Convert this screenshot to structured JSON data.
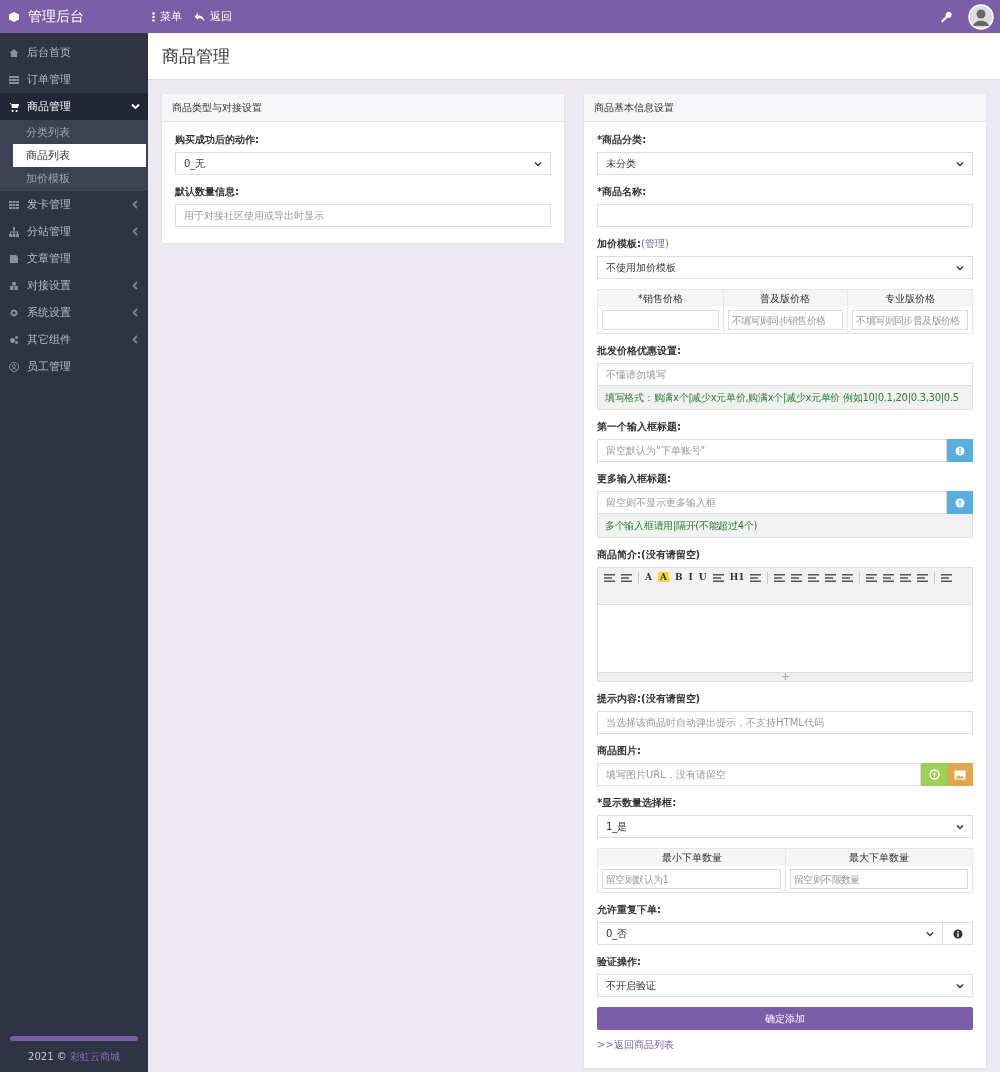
{
  "topbar": {
    "brand": "管理后台",
    "menu_button": "菜单",
    "back_button": "返回"
  },
  "sidebar": {
    "items": [
      {
        "kind": "link",
        "label": "后台首页",
        "selected": false
      },
      {
        "kind": "link",
        "label": "订单管理",
        "selected": false
      },
      {
        "kind": "group",
        "label": "商品管理",
        "expanded": true,
        "selected": true,
        "children": [
          {
            "label": "分类列表",
            "selected": false
          },
          {
            "label": "商品列表",
            "selected": true
          },
          {
            "label": "加价模板",
            "selected": false
          }
        ]
      },
      {
        "kind": "group",
        "label": "发卡管理",
        "expanded": false,
        "selected": false
      },
      {
        "kind": "group",
        "label": "分站管理",
        "expanded": false,
        "selected": false
      },
      {
        "kind": "link",
        "label": "文章管理",
        "selected": false
      },
      {
        "kind": "group",
        "label": "对接设置",
        "expanded": false,
        "selected": false
      },
      {
        "kind": "group",
        "label": "系统设置",
        "expanded": false,
        "selected": false
      },
      {
        "kind": "group",
        "label": "其它组件",
        "expanded": false,
        "selected": false
      },
      {
        "kind": "link",
        "label": "员工管理",
        "selected": false
      }
    ],
    "footer": {
      "year": "2021 ©",
      "link": "彩虹云商城"
    }
  },
  "page_title": "商品管理",
  "left_panel": {
    "title": "商品类型与对接设置",
    "fields": [
      {
        "kind": "select",
        "label": "购买成功后的动作:",
        "value": "0_无"
      },
      {
        "kind": "input",
        "label": "默认数量信息:",
        "placeholder": "用于对接社区使用或导出时显示"
      }
    ]
  },
  "right_panel": {
    "title": "商品基本信息设置",
    "fields": [
      {
        "kind": "select",
        "label": "*商品分类:",
        "value": "未分类"
      },
      {
        "kind": "input",
        "label": "*商品名称:"
      },
      {
        "kind": "select",
        "label": "加价模板:",
        "label_link": "(管理)",
        "value": "不使用加价模板"
      },
      {
        "kind": "table",
        "columns": [
          {
            "header": "*销售价格"
          },
          {
            "header": "普及版价格",
            "placeholder": "不填写则同步销售价格"
          },
          {
            "header": "专业版价格",
            "placeholder": "不填写则同步普及版价格"
          }
        ]
      },
      {
        "kind": "input",
        "label": "批发价格优惠设置:",
        "placeholder": "不懂请勿填写",
        "note": "填写格式：购满x个|减少x元单价,购满x个|减少x元单价  例如10|0.1,20|0.3,30|0.5"
      },
      {
        "kind": "input",
        "label": "第一个输入框标题:",
        "placeholder": "留空默认为\"下单账号\"",
        "addons": [
          {
            "kind": "info"
          }
        ]
      },
      {
        "kind": "input",
        "label": "更多输入框标题:",
        "placeholder": "留空则不显示更多输入框",
        "addons": [
          {
            "kind": "info"
          }
        ],
        "note": "多个输入框请用|隔开(不能超过4个)"
      },
      {
        "kind": "editor",
        "label": "**商品简介:**(没有请留空)",
        "toolbar": [
          {
            "kind": "icon"
          },
          {
            "kind": "icon"
          },
          {
            "kind": "sep"
          },
          {
            "kind": "text",
            "text": "A"
          },
          {
            "kind": "highlight",
            "text": "A"
          },
          {
            "kind": "text",
            "text": "B"
          },
          {
            "kind": "text",
            "text": "I"
          },
          {
            "kind": "text",
            "text": "U"
          },
          {
            "kind": "icon"
          },
          {
            "kind": "text",
            "text": "H1"
          },
          {
            "kind": "icon"
          },
          {
            "kind": "sep"
          },
          {
            "kind": "icon"
          },
          {
            "kind": "icon"
          },
          {
            "kind": "icon"
          },
          {
            "kind": "icon"
          },
          {
            "kind": "icon"
          },
          {
            "kind": "sep"
          },
          {
            "kind": "icon"
          },
          {
            "kind": "icon"
          },
          {
            "kind": "icon"
          },
          {
            "kind": "icon"
          },
          {
            "kind": "sep"
          },
          {
            "kind": "icon"
          }
        ]
      },
      {
        "kind": "input",
        "label": "**提示内容:**(没有请留空)",
        "placeholder": "当选择该商品时自动弹出提示，不支持HTML代码"
      },
      {
        "kind": "input",
        "label": "商品图片:",
        "placeholder": "填写图片URL，没有请留空",
        "addons": [
          {
            "kind": "upload"
          },
          {
            "kind": "image"
          }
        ]
      },
      {
        "kind": "select",
        "label": "*显示数量选择框:",
        "value": "1_是"
      },
      {
        "kind": "table",
        "columns": [
          {
            "header": "最小下单数量",
            "placeholder": "留空则默认为1"
          },
          {
            "header": "最大下单数量",
            "placeholder": "留空则不限数量"
          }
        ]
      },
      {
        "kind": "select",
        "label": "允许重复下单:",
        "value": "0_否",
        "addons": [
          {
            "kind": "info_plain"
          }
        ]
      },
      {
        "kind": "select",
        "label": "验证操作:",
        "value": "不开启验证"
      },
      {
        "kind": "button",
        "text": "确定添加"
      },
      {
        "kind": "link",
        "prefix": ">>",
        "text": "返回商品列表"
      }
    ]
  }
}
